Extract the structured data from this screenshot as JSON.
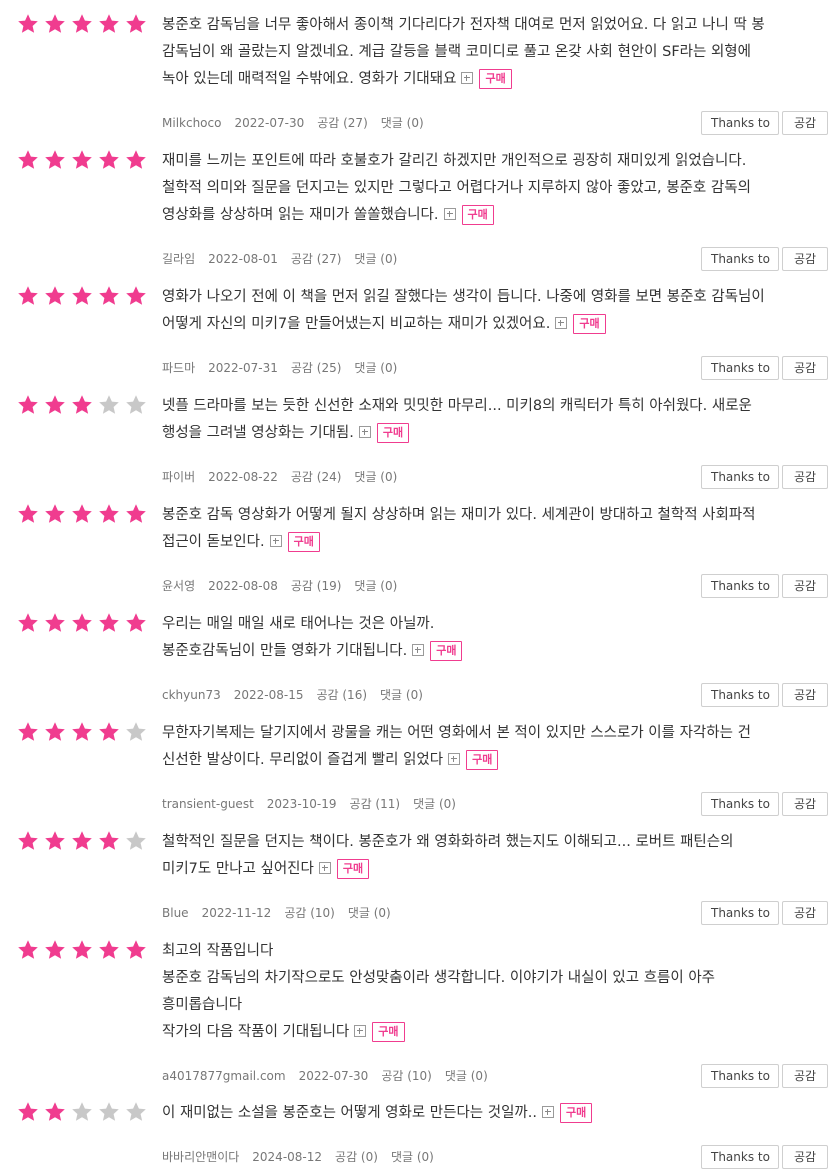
{
  "colors": {
    "star_filled": "#f03c8f",
    "star_empty": "#c8c8c8",
    "buy_badge": "#f03c8f"
  },
  "icons": {
    "rating": "star-icon",
    "expand": "expand-plus-icon"
  },
  "reviews": [
    {
      "rating": 5,
      "lines": [
        "봉준호 감독님을 너무 좋아해서 종이책 기다리다가 전자책 대여로 먼저 읽었어요. 다 읽고 나니 딱 봉",
        "감독님이 왜 골랐는지 알겠네요. 계급 갈등을 블랙 코미디로 풀고 온갖 사회 현안이 SF라는 외형에",
        "녹아 있는데 매력적일 수밖에요. 영화가 기대돼요"
      ],
      "buy_label": "구매",
      "user": "Milkchoco",
      "date": "2022-07-30",
      "likes": "공감 (27)",
      "comments": "댓글 (0)",
      "thanks_label": "Thanks to",
      "like_label": "공감"
    },
    {
      "rating": 5,
      "lines": [
        "재미를 느끼는 포인트에 따라 호불호가 갈리긴 하겠지만 개인적으로 굉장히 재미있게 읽었습니다.",
        "철학적 의미와 질문을 던지고는 있지만 그렇다고 어렵다거나 지루하지 않아 좋았고, 봉준호 감독의",
        "영상화를 상상하며 읽는 재미가 쏠쏠했습니다."
      ],
      "buy_label": "구매",
      "user": "길라임",
      "date": "2022-08-01",
      "likes": "공감 (27)",
      "comments": "댓글 (0)",
      "thanks_label": "Thanks to",
      "like_label": "공감"
    },
    {
      "rating": 5,
      "lines": [
        "영화가 나오기 전에 이 책을 먼저 읽길 잘했다는 생각이 듭니다. 나중에 영화를 보면 봉준호 감독님이",
        "어떻게 자신의 미키7을 만들어냈는지 비교하는 재미가 있겠어요."
      ],
      "buy_label": "구매",
      "user": "파드마",
      "date": "2022-07-31",
      "likes": "공감 (25)",
      "comments": "댓글 (0)",
      "thanks_label": "Thanks to",
      "like_label": "공감"
    },
    {
      "rating": 3,
      "lines": [
        "넷플 드라마를 보는 듯한 신선한 소재와 밋밋한 마무리... 미키8의 캐릭터가 특히 아쉬웠다. 새로운",
        "행성을 그려낼 영상화는 기대됨."
      ],
      "buy_label": "구매",
      "user": "파이버",
      "date": "2022-08-22",
      "likes": "공감 (24)",
      "comments": "댓글 (0)",
      "thanks_label": "Thanks to",
      "like_label": "공감"
    },
    {
      "rating": 5,
      "lines": [
        "봉준호 감독 영상화가 어떻게 될지 상상하며 읽는 재미가 있다. 세계관이 방대하고 철학적 사회파적",
        "접근이 돋보인다."
      ],
      "buy_label": "구매",
      "user": "윤서영",
      "date": "2022-08-08",
      "likes": "공감 (19)",
      "comments": "댓글 (0)",
      "thanks_label": "Thanks to",
      "like_label": "공감"
    },
    {
      "rating": 5,
      "lines": [
        "우리는 매일 매일 새로 태어나는 것은 아닐까.",
        "봉준호감독님이 만들 영화가 기대됩니다."
      ],
      "buy_label": "구매",
      "user": "ckhyun73",
      "date": "2022-08-15",
      "likes": "공감 (16)",
      "comments": "댓글 (0)",
      "thanks_label": "Thanks to",
      "like_label": "공감"
    },
    {
      "rating": 4,
      "lines": [
        "무한자기복제는 달기지에서 광물을 캐는 어떤 영화에서 본 적이 있지만 스스로가 이를 자각하는 건",
        "신선한 발상이다. 무리없이 즐겁게 빨리 읽었다"
      ],
      "buy_label": "구매",
      "user": "transient-guest",
      "date": "2023-10-19",
      "likes": "공감 (11)",
      "comments": "댓글 (0)",
      "thanks_label": "Thanks to",
      "like_label": "공감"
    },
    {
      "rating": 4,
      "lines": [
        "철학적인 질문을 던지는 책이다. 봉준호가 왜 영화화하려 했는지도 이해되고... 로버트 패틴슨의",
        "미키7도 만나고 싶어진다"
      ],
      "buy_label": "구매",
      "user": "Blue",
      "date": "2022-11-12",
      "likes": "공감 (10)",
      "comments": "댓글 (0)",
      "thanks_label": "Thanks to",
      "like_label": "공감"
    },
    {
      "rating": 5,
      "lines": [
        "최고의 작품입니다",
        "봉준호 감독님의 차기작으로도 안성맞춤이라 생각합니다. 이야기가 내실이 있고 흐름이 아주",
        "흥미롭습니다",
        "작가의 다음 작품이 기대됩니다"
      ],
      "buy_label": "구매",
      "user": "a4017877gmail.com",
      "date": "2022-07-30",
      "likes": "공감 (10)",
      "comments": "댓글 (0)",
      "thanks_label": "Thanks to",
      "like_label": "공감"
    },
    {
      "rating": 2,
      "lines": [
        "이 재미없는 소설을 봉준호는 어떻게 영화로 만든다는 것일까.."
      ],
      "buy_label": "구매",
      "user": "바바리안맨이다",
      "date": "2024-08-12",
      "likes": "공감 (0)",
      "comments": "댓글 (0)",
      "thanks_label": "Thanks to",
      "like_label": "공감"
    }
  ]
}
